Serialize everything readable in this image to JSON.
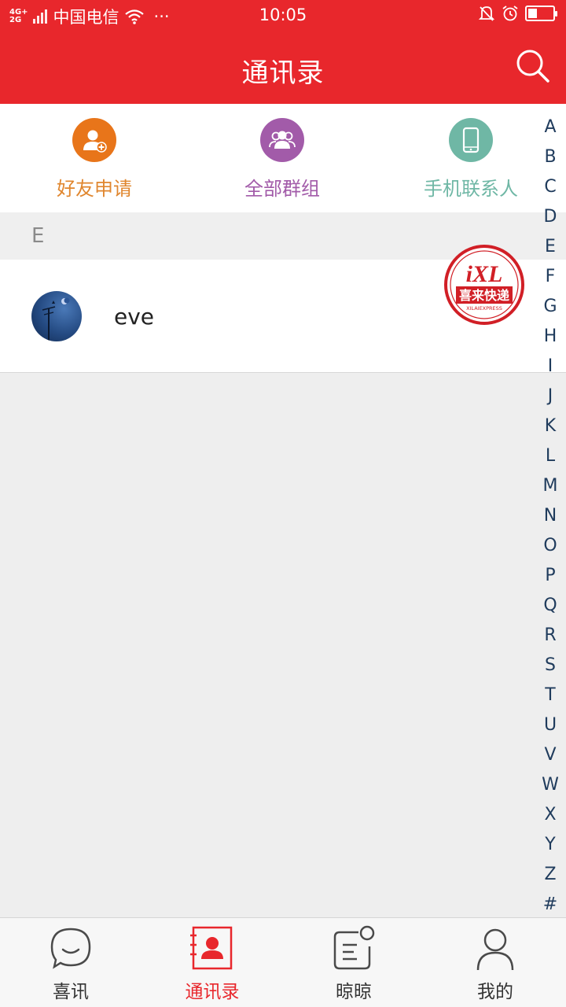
{
  "status_bar": {
    "network": "4G 2G",
    "carrier": "中国电信",
    "more": "···",
    "time": "10:05",
    "battery_level": 0.35
  },
  "header": {
    "title": "通讯录"
  },
  "shortcuts": [
    {
      "label": "好友申请",
      "color": "#e8751a",
      "icon": "add-friend-icon"
    },
    {
      "label": "全部群组",
      "color": "#a25ba9",
      "icon": "group-icon"
    },
    {
      "label": "手机联系人",
      "color": "#6fb7a5",
      "icon": "phone-icon"
    }
  ],
  "section": {
    "letter": "E"
  },
  "contacts": [
    {
      "name": "eve",
      "avatar": "night-sky-avatar"
    }
  ],
  "stamp": {
    "brand": "iXL",
    "name": "喜来快递",
    "sub": "XILAIEXPRESS"
  },
  "index_letters": [
    "A",
    "B",
    "C",
    "D",
    "E",
    "F",
    "G",
    "H",
    "I",
    "J",
    "K",
    "L",
    "M",
    "N",
    "O",
    "P",
    "Q",
    "R",
    "S",
    "T",
    "U",
    "V",
    "W",
    "X",
    "Y",
    "Z",
    "#"
  ],
  "bottom_nav": [
    {
      "label": "喜讯",
      "icon": "chat-bubble-icon",
      "active": false
    },
    {
      "label": "通讯录",
      "icon": "contacts-book-icon",
      "active": true
    },
    {
      "label": "晾晾",
      "icon": "moments-icon",
      "active": false
    },
    {
      "label": "我的",
      "icon": "profile-icon",
      "active": false
    }
  ],
  "colors": {
    "brand_red": "#e8272c",
    "index_text": "#1f3b5c",
    "background": "#eeeeee"
  }
}
